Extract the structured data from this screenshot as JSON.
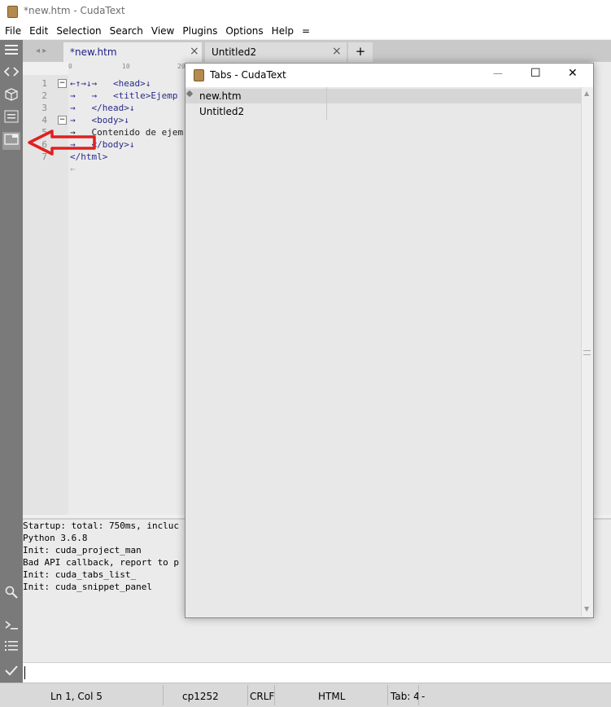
{
  "window": {
    "title": "*new.htm - CudaText"
  },
  "menu": [
    "File",
    "Edit",
    "Selection",
    "Search",
    "View",
    "Plugins",
    "Options",
    "Help",
    "="
  ],
  "tabs": [
    {
      "label": "*new.htm",
      "active": true
    },
    {
      "label": "Untitled2",
      "active": false
    }
  ],
  "tab_controls": {
    "add": "+",
    "close": "×",
    "nav": "◂ ▸"
  },
  "ruler": {
    "marks": [
      "0",
      "10",
      "20"
    ]
  },
  "editor": {
    "line_numbers": [
      "1",
      "2",
      "3",
      "4",
      "5",
      "6",
      "7"
    ],
    "lines": [
      "←↑→↓→   <head>↓",
      "→   →   <title>Ejemp",
      "→   </head>↓",
      "→   <body>↓",
      "→   Contenido de ejem",
      "→   </body>↓",
      "</html>",
      "←"
    ]
  },
  "console": {
    "lines": [
      "Startup: total: 750ms, incluc",
      "Python 3.6.8",
      "Init: cuda_project_man",
      "Bad API callback, report to p",
      "Init: cuda_tabs_list_",
      "Init: cuda_snippet_panel"
    ],
    "input_value": ""
  },
  "statusbar": {
    "position": "Ln 1, Col 5",
    "encoding": "cp1252",
    "line_ending": "CRLF",
    "lexer": "HTML",
    "tab_size": "Tab: 4",
    "extra": "-"
  },
  "dialog": {
    "title": "Tabs - CudaText",
    "items": [
      {
        "label": "new.htm",
        "selected": true
      },
      {
        "label": "Untitled2",
        "selected": false
      }
    ],
    "buttons": {
      "minimize": "—",
      "maximize": "☐",
      "close": "✕"
    }
  },
  "sidebar_icons": [
    "menu-icon",
    "code-icon",
    "box-icon",
    "list-icon",
    "tabs-panel-icon",
    "search-icon",
    "console-icon",
    "output-list-icon",
    "check-icon"
  ],
  "colors": {
    "sidebar": "#7a7a7a",
    "arrow": "#e02020",
    "tag": "#2a2a8a"
  }
}
